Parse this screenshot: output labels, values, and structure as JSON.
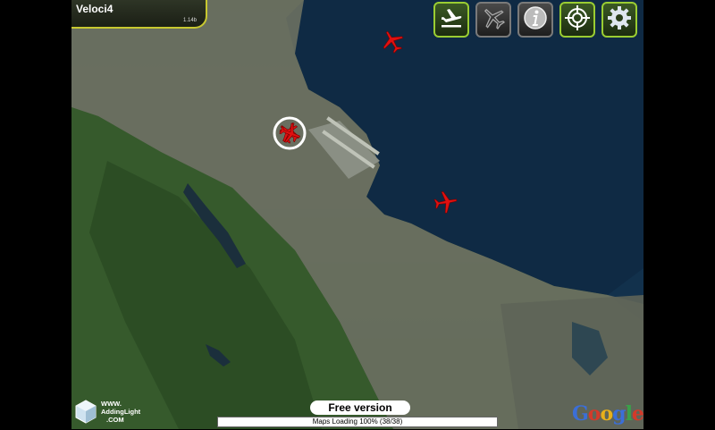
{
  "app": {
    "title": "Veloci4",
    "version": "1.14b"
  },
  "toolbar": {
    "buttons": [
      {
        "name": "airport-icon"
      },
      {
        "name": "disabled-plane-icon"
      },
      {
        "name": "info-icon"
      },
      {
        "name": "target-icon"
      },
      {
        "name": "gear-icon"
      }
    ]
  },
  "status": {
    "free_label": "Free version",
    "loading_label": "Maps Loading  100% (38/38)",
    "loading_progress": 1.0
  },
  "branding": {
    "logo_line1": "WWW.",
    "logo_line2": "AddingLight",
    "logo_line3": ".COM",
    "map_provider": "Google"
  },
  "colors": {
    "accent": "#c8c830",
    "plane": "#e01010",
    "water": "#0f2a44"
  }
}
